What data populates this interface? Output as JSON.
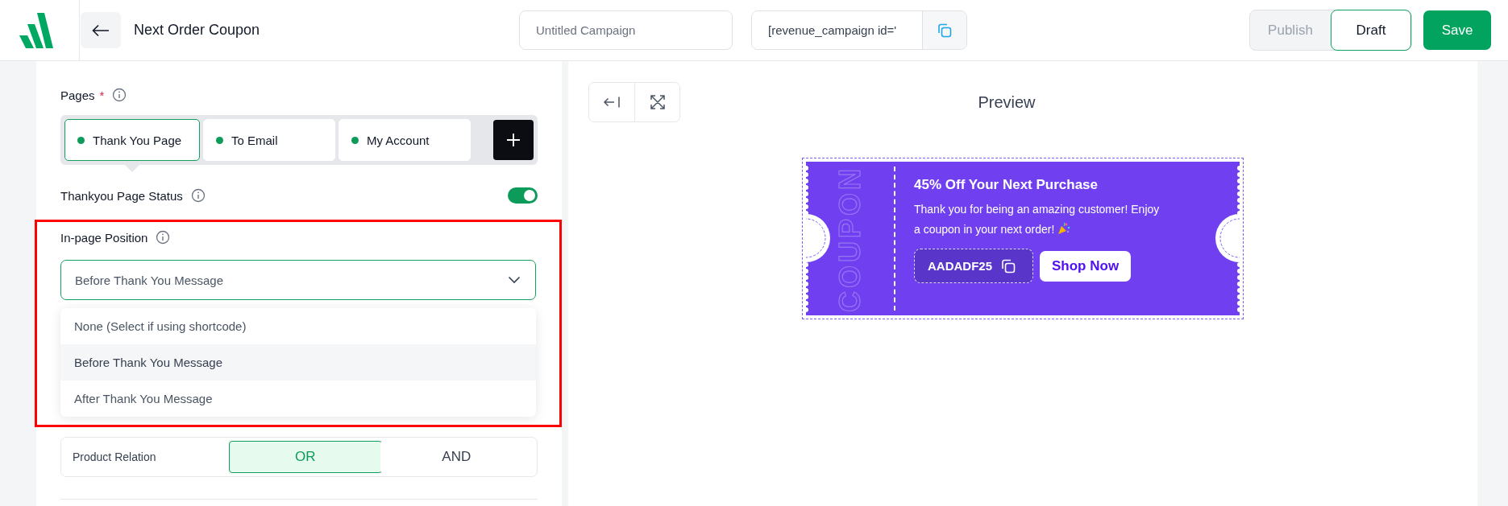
{
  "app_bar": {
    "title": "Next Order Coupon",
    "campaign_name": {
      "placeholder": "Untitled Campaign"
    },
    "shortcode": {
      "value": "[revenue_campaign id='"
    },
    "status_options": [
      {
        "label": "Publish",
        "selected": false
      },
      {
        "label": "Draft",
        "selected": true
      }
    ],
    "save_label": "Save"
  },
  "settings": {
    "pages": {
      "label": "Pages",
      "required_mark": "*",
      "tabs": [
        {
          "label": "Thank You Page",
          "selected": true
        },
        {
          "label": "To Email",
          "selected": false
        },
        {
          "label": "My Account",
          "selected": false
        }
      ]
    },
    "thankyou_status": {
      "label": "Thankyou Page Status",
      "on": true
    },
    "position": {
      "label": "In-page Position",
      "value": "Before Thank You Message",
      "expanded": true,
      "options": [
        {
          "label": "None (Select if using shortcode)",
          "selected": false
        },
        {
          "label": "Before Thank You Message",
          "selected": true
        },
        {
          "label": "After Thank You Message",
          "selected": false
        }
      ]
    },
    "product_relation": {
      "label": "Product Relation",
      "options": [
        {
          "label": "OR",
          "selected": true
        },
        {
          "label": "AND",
          "selected": false
        }
      ]
    }
  },
  "preview": {
    "title": "Preview",
    "coupon": {
      "side_label": "COUPON",
      "heading": "45% Off Your Next Purchase",
      "message": "Thank you for being an amazing customer! Enjoy a coupon in your next order!",
      "code": "AADADF25",
      "button_label": "Shop Now"
    }
  }
}
